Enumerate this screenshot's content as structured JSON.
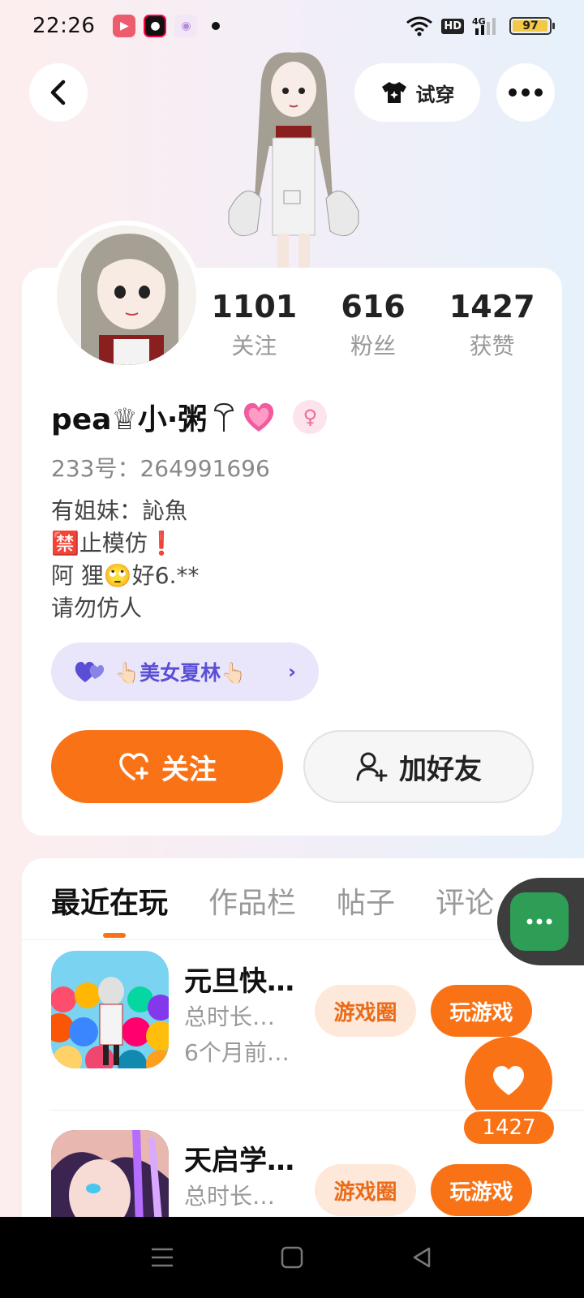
{
  "status_bar": {
    "time": "22:26",
    "network": "4G",
    "hd": "HD",
    "battery": "97",
    "battery_level": 0.97
  },
  "header": {
    "tryon_label": "试穿"
  },
  "profile": {
    "stats": [
      {
        "value": "1101",
        "label": "关注"
      },
      {
        "value": "616",
        "label": "粉丝"
      },
      {
        "value": "1427",
        "label": "获赞"
      }
    ],
    "nickname": "pea♕小·粥",
    "uid": "233号：264991696",
    "bio": [
      "有姐妹：訫魚",
      "🈲止模仿❗",
      "阿 狸🙄好6.**",
      "请勿仿人"
    ],
    "tag": "👆🏻美女夏林👆🏻",
    "follow_label": "关注",
    "add_friend_label": "加好友",
    "accent_color": "#f97316"
  },
  "tabs": [
    {
      "label": "最近在玩",
      "active": true
    },
    {
      "label": "作品栏",
      "active": false
    },
    {
      "label": "帖子",
      "active": false
    },
    {
      "label": "评论",
      "active": false
    }
  ],
  "games": [
    {
      "title": "元旦快…",
      "duration": "总时长…",
      "last_played": "6个月前…",
      "circle_label": "游戏圈",
      "play_label": "玩游戏"
    },
    {
      "title": "天启学…",
      "duration": "总时长…",
      "circle_label": "游戏圈",
      "play_label": "玩游戏"
    }
  ],
  "floating": {
    "like_count": "1427"
  }
}
